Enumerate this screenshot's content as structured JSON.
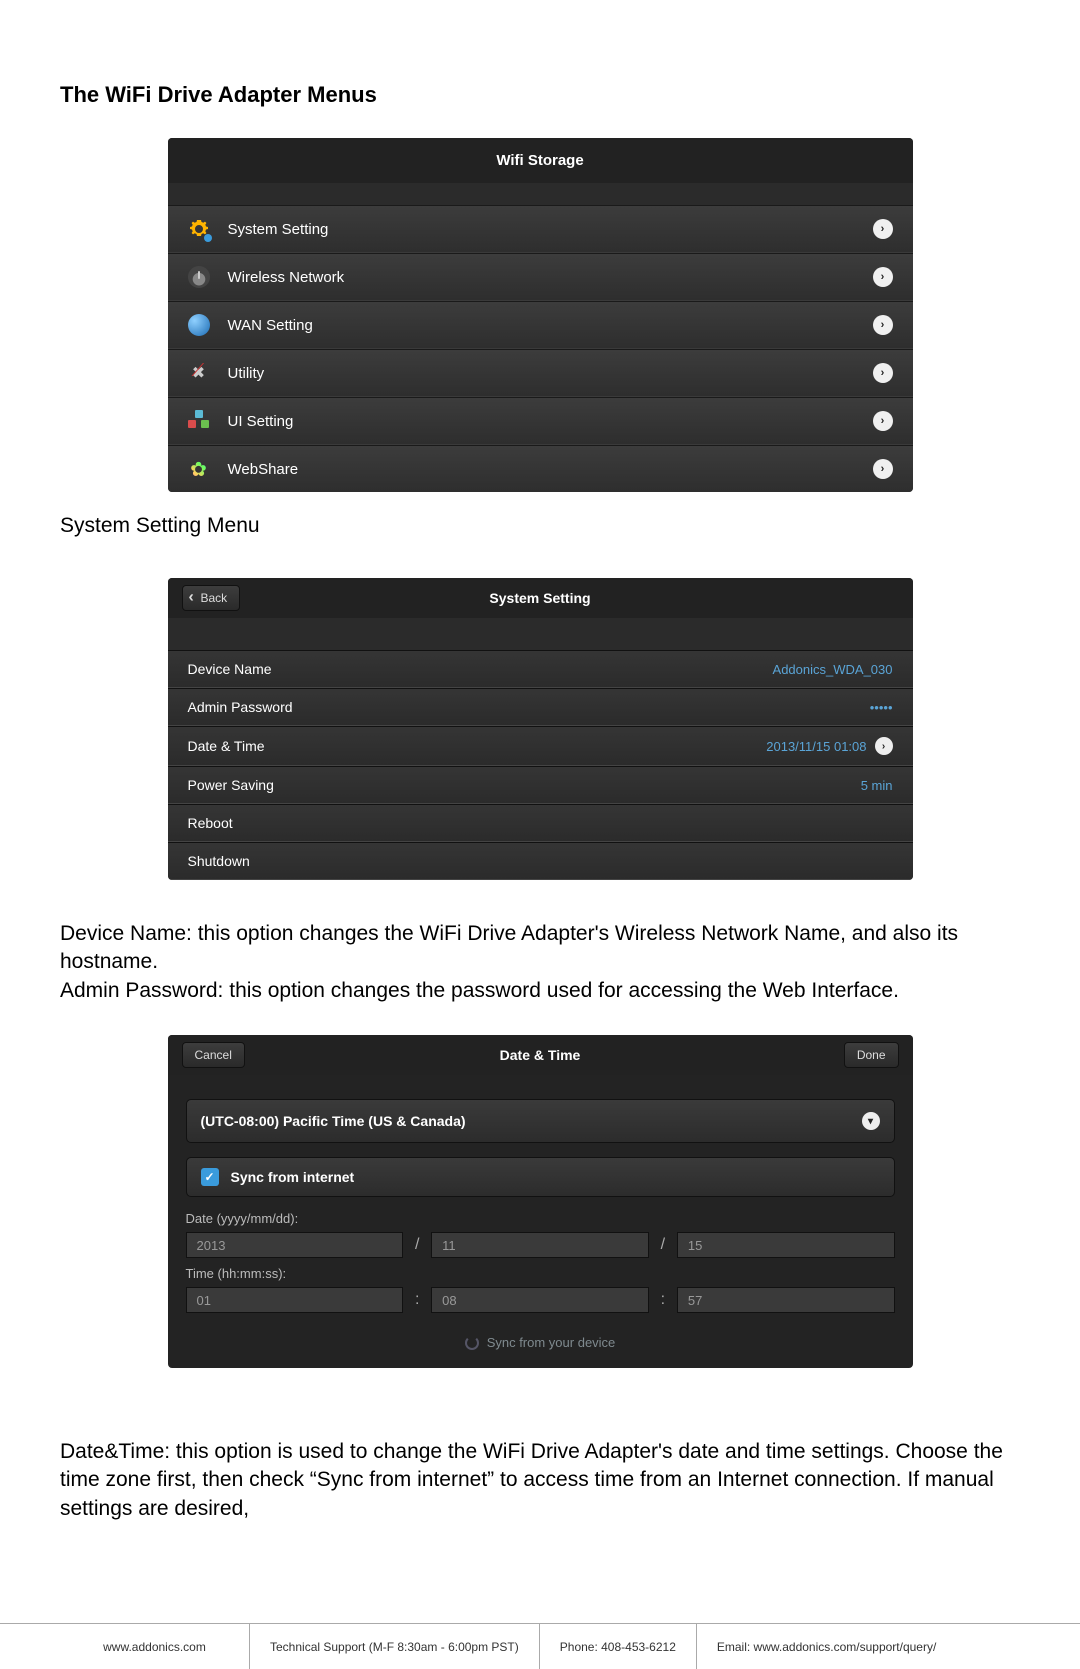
{
  "title": "The WiFi Drive Adapter Menus",
  "captions": {
    "system_setting_menu": "System Setting Menu"
  },
  "paragraphs": {
    "device_name_desc": "Device Name: this option changes the WiFi Drive Adapter's Wireless Network Name, and also its hostname.",
    "admin_password_desc": "Admin Password: this option changes the password used for accessing the Web Interface.",
    "date_time_desc": "Date&Time: this option is used to change the WiFi Drive Adapter's date and time settings. Choose the time zone first, then check “Sync from internet” to access time from an Internet connection. If manual settings are desired,"
  },
  "wifi_storage": {
    "header": "Wifi Storage",
    "items": [
      {
        "label": "System Setting",
        "icon": "gear"
      },
      {
        "label": "Wireless Network",
        "icon": "wifi"
      },
      {
        "label": "WAN Setting",
        "icon": "globe"
      },
      {
        "label": "Utility",
        "icon": "tools"
      },
      {
        "label": "UI Setting",
        "icon": "ui"
      },
      {
        "label": "WebShare",
        "icon": "flower"
      }
    ]
  },
  "system_setting": {
    "header": "System Setting",
    "back": "Back",
    "rows": [
      {
        "label": "Device Name",
        "value": "Addonics_WDA_030",
        "arrow": false
      },
      {
        "label": "Admin Password",
        "value": "•••••",
        "arrow": false
      },
      {
        "label": "Date & Time",
        "value": "2013/11/15 01:08",
        "arrow": true
      },
      {
        "label": "Power Saving",
        "value": "5 min",
        "arrow": false
      },
      {
        "label": "Reboot",
        "value": "",
        "arrow": false
      },
      {
        "label": "Shutdown",
        "value": "",
        "arrow": false
      }
    ]
  },
  "date_time": {
    "header": "Date & Time",
    "cancel": "Cancel",
    "done": "Done",
    "timezone": "(UTC-08:00) Pacific Time (US & Canada)",
    "sync_internet": "Sync from internet",
    "date_label": "Date (yyyy/mm/dd):",
    "date": {
      "y": "2013",
      "m": "11",
      "d": "15"
    },
    "date_sep": "/",
    "time_label": "Time (hh:mm:ss):",
    "time": {
      "h": "01",
      "m": "08",
      "s": "57"
    },
    "time_sep": ":",
    "sync_device": "Sync from your device"
  },
  "footer": {
    "site": "www.addonics.com",
    "support": "Technical Support (M-F 8:30am - 6:00pm PST)",
    "phone": "Phone: 408-453-6212",
    "email": "Email: www.addonics.com/support/query/"
  }
}
